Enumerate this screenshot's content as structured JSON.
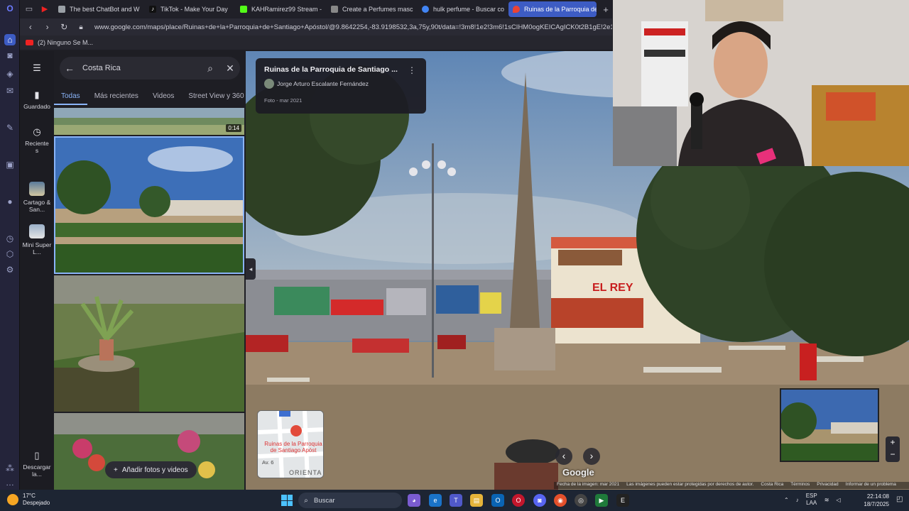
{
  "browser": {
    "tabs": [
      {
        "label": "The best ChatBot and W",
        "icon": "chatbot-favicon",
        "color": "#9aa0a6"
      },
      {
        "label": "TikTok - Make Your Day",
        "icon": "tiktok-favicon",
        "color": "#111111"
      },
      {
        "label": "KAHRamirez99 Stream -",
        "icon": "kick-favicon",
        "color": "#53fc18"
      },
      {
        "label": "Create a Perfumes masc",
        "icon": "doc-favicon",
        "color": "#888888"
      },
      {
        "label": "hulk perfume - Buscar co",
        "icon": "google-favicon",
        "color": "#4285f4"
      },
      {
        "label": "Ruinas de la Parroquia de",
        "icon": "maps-favicon",
        "color": "#ea4335",
        "active": true
      }
    ],
    "url": "www.google.com/maps/place/Ruinas+de+la+Parroquia+de+Santiago+Apóstol/@9.8642254,-83.9198532,3a,75y,90t/data=!3m8!1e2!3m6!1sCIHM0ogKEICAgICK0t2B1gE!2e10!3e12!6s",
    "bookmark": "(2) Ninguno Se M..."
  },
  "maps_rail": {
    "menu_icon": "menu-icon",
    "saved": "Guardado",
    "recent": "Reciente s",
    "place1": "Cartago & San...",
    "place2": "Mini Super L...",
    "download": "Descargar la..."
  },
  "panel": {
    "search_value": "Costa Rica",
    "tabs": [
      "Todas",
      "Más recientes",
      "Videos",
      "Street View y 360"
    ],
    "video_duration": "0:14",
    "add_button": "Añadir fotos y videos"
  },
  "streetview": {
    "title": "Ruinas de la Parroquia de Santiago ...",
    "author": "Jorge Arturo Escalante Fernández",
    "date": "Foto - mar 2021",
    "store_sign": "EL REY",
    "minimap_label": "Ruinas de la Parroquia de Santiago Apóst",
    "minimap_avenue": "Av. 6",
    "minimap_orient": "ORIENTA",
    "google": "Google",
    "footer": [
      "Fecha de la imagen: mar 2021",
      "Las imágenes pueden estar protegidas por derechos de autor.",
      "Costa Rica",
      "Términos",
      "Privacidad",
      "Informar de un problema"
    ]
  },
  "taskbar": {
    "temp": "17°C",
    "condition": "Despejado",
    "search_placeholder": "Buscar",
    "lang_top": "ESP",
    "lang_bottom": "LAA",
    "time": "22:14:08",
    "date": "18/7/2025"
  }
}
